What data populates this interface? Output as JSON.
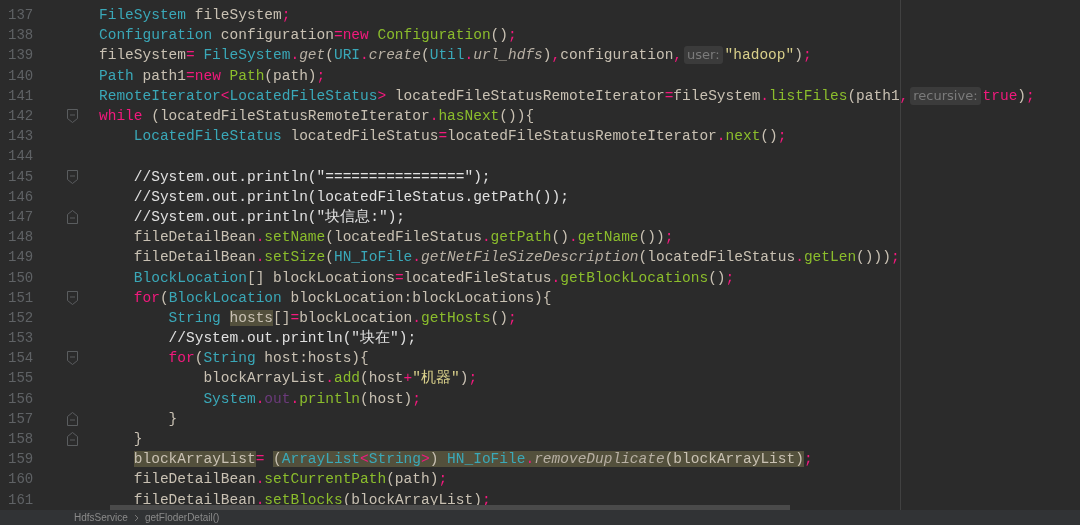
{
  "editor": {
    "lines": [
      {
        "number": "137",
        "fold_open": false,
        "fold_close": false,
        "tokens": [
          {
            "kind": "type",
            "t": "FileSystem",
            "highlighted": false
          },
          {
            "kind": "plain",
            "t": " fileSystem",
            "highlighted": false
          },
          {
            "kind": "punct",
            "t": ";",
            "highlighted": false
          }
        ]
      },
      {
        "number": "138",
        "fold_open": false,
        "fold_close": false,
        "tokens": [
          {
            "kind": "type",
            "t": "Configuration",
            "highlighted": false
          },
          {
            "kind": "plain",
            "t": " configuration",
            "highlighted": false
          },
          {
            "kind": "punct",
            "t": "=",
            "highlighted": false
          },
          {
            "kind": "kw",
            "t": "new",
            "highlighted": false
          },
          {
            "kind": "call",
            "t": " Configuration",
            "highlighted": false
          },
          {
            "kind": "plain",
            "t": "()",
            "highlighted": false
          },
          {
            "kind": "punct",
            "t": ";",
            "highlighted": false
          }
        ]
      },
      {
        "number": "139",
        "fold_open": false,
        "fold_close": false,
        "tokens": [
          {
            "kind": "plain",
            "t": "fileSystem",
            "highlighted": false
          },
          {
            "kind": "punct",
            "t": "=",
            "highlighted": false
          },
          {
            "kind": "type",
            "t": " FileSystem",
            "highlighted": false
          },
          {
            "kind": "punct",
            "t": ".",
            "highlighted": false
          },
          {
            "kind": "static",
            "t": "get",
            "highlighted": false
          },
          {
            "kind": "plain",
            "t": "(",
            "highlighted": false
          },
          {
            "kind": "type",
            "t": "URI",
            "highlighted": false
          },
          {
            "kind": "punct",
            "t": ".",
            "highlighted": false
          },
          {
            "kind": "static",
            "t": "create",
            "highlighted": false
          },
          {
            "kind": "plain",
            "t": "(",
            "highlighted": false
          },
          {
            "kind": "type",
            "t": "Util",
            "highlighted": false
          },
          {
            "kind": "punct",
            "t": ".",
            "highlighted": false
          },
          {
            "kind": "static",
            "t": "url_hdfs",
            "highlighted": false
          },
          {
            "kind": "plain",
            "t": ")",
            "highlighted": false
          },
          {
            "kind": "punct",
            "t": ",",
            "highlighted": false
          },
          {
            "kind": "plain",
            "t": "configuration",
            "highlighted": false
          },
          {
            "kind": "punct",
            "t": ",",
            "highlighted": false
          },
          {
            "kind": "hint",
            "t": "user:",
            "highlighted": false
          },
          {
            "kind": "str",
            "t": "\"hadoop\"",
            "highlighted": false
          },
          {
            "kind": "plain",
            "t": ")",
            "highlighted": false
          },
          {
            "kind": "punct",
            "t": ";",
            "highlighted": false
          }
        ]
      },
      {
        "number": "140",
        "fold_open": false,
        "fold_close": false,
        "tokens": [
          {
            "kind": "type",
            "t": "Path",
            "highlighted": false
          },
          {
            "kind": "plain",
            "t": " path1",
            "highlighted": false
          },
          {
            "kind": "punct",
            "t": "=",
            "highlighted": false
          },
          {
            "kind": "kw",
            "t": "new",
            "highlighted": false
          },
          {
            "kind": "call",
            "t": " Path",
            "highlighted": false
          },
          {
            "kind": "plain",
            "t": "(path)",
            "highlighted": false
          },
          {
            "kind": "punct",
            "t": ";",
            "highlighted": false
          }
        ]
      },
      {
        "number": "141",
        "fold_open": false,
        "fold_close": false,
        "tokens": [
          {
            "kind": "type",
            "t": "RemoteIterator",
            "highlighted": false
          },
          {
            "kind": "punct",
            "t": "<",
            "highlighted": false
          },
          {
            "kind": "type",
            "t": "LocatedFileStatus",
            "highlighted": false
          },
          {
            "kind": "punct",
            "t": ">",
            "highlighted": false
          },
          {
            "kind": "plain",
            "t": " locatedFileStatusRemoteIterator",
            "highlighted": false
          },
          {
            "kind": "punct",
            "t": "=",
            "highlighted": false
          },
          {
            "kind": "plain",
            "t": "fileSystem",
            "highlighted": false
          },
          {
            "kind": "punct",
            "t": ".",
            "highlighted": false
          },
          {
            "kind": "call",
            "t": "listFiles",
            "highlighted": false
          },
          {
            "kind": "plain",
            "t": "(path1",
            "highlighted": false
          },
          {
            "kind": "punct",
            "t": ",",
            "highlighted": false
          },
          {
            "kind": "hint",
            "t": "recursive:",
            "highlighted": false
          },
          {
            "kind": "kw",
            "t": "true",
            "highlighted": false
          },
          {
            "kind": "plain",
            "t": ")",
            "highlighted": false
          },
          {
            "kind": "punct",
            "t": ";",
            "highlighted": false
          }
        ]
      },
      {
        "number": "142",
        "fold_open": true,
        "fold_close": false,
        "tokens": [
          {
            "kind": "kw",
            "t": "while",
            "highlighted": false
          },
          {
            "kind": "plain",
            "t": " (locatedFileStatusRemoteIterator",
            "highlighted": false
          },
          {
            "kind": "punct",
            "t": ".",
            "highlighted": false
          },
          {
            "kind": "call",
            "t": "hasNext",
            "highlighted": false
          },
          {
            "kind": "plain",
            "t": "()){",
            "highlighted": false
          }
        ]
      },
      {
        "number": "143",
        "fold_open": false,
        "fold_close": false,
        "tokens": [
          {
            "kind": "type",
            "t": "    LocatedFileStatus",
            "highlighted": false
          },
          {
            "kind": "plain",
            "t": " locatedFileStatus",
            "highlighted": false
          },
          {
            "kind": "punct",
            "t": "=",
            "highlighted": false
          },
          {
            "kind": "plain",
            "t": "locatedFileStatusRemoteIterator",
            "highlighted": false
          },
          {
            "kind": "punct",
            "t": ".",
            "highlighted": false
          },
          {
            "kind": "call",
            "t": "next",
            "highlighted": false
          },
          {
            "kind": "plain",
            "t": "()",
            "highlighted": false
          },
          {
            "kind": "punct",
            "t": ";",
            "highlighted": false
          }
        ]
      },
      {
        "number": "144",
        "fold_open": false,
        "fold_close": false
      },
      {
        "number": "145",
        "fold_open": true,
        "fold_close": false,
        "tokens": [
          {
            "kind": "comment",
            "t": "    //System.out.println(\"================\");",
            "highlighted": false
          }
        ]
      },
      {
        "number": "146",
        "fold_open": false,
        "fold_close": false,
        "tokens": [
          {
            "kind": "comment",
            "t": "    //System.out.println(locatedFileStatus.getPath());",
            "highlighted": false
          }
        ]
      },
      {
        "number": "147",
        "fold_open": false,
        "fold_close": true,
        "tokens": [
          {
            "kind": "comment",
            "t": "    //System.out.println(\"块信息:\");",
            "highlighted": false
          }
        ]
      },
      {
        "number": "148",
        "fold_open": false,
        "fold_close": false,
        "tokens": [
          {
            "kind": "plain",
            "t": "    fileDetailBean",
            "highlighted": false
          },
          {
            "kind": "punct",
            "t": ".",
            "highlighted": false
          },
          {
            "kind": "call",
            "t": "setName",
            "highlighted": false
          },
          {
            "kind": "plain",
            "t": "(locatedFileStatus",
            "highlighted": false
          },
          {
            "kind": "punct",
            "t": ".",
            "highlighted": false
          },
          {
            "kind": "call",
            "t": "getPath",
            "highlighted": false
          },
          {
            "kind": "plain",
            "t": "()",
            "highlighted": false
          },
          {
            "kind": "punct",
            "t": ".",
            "highlighted": false
          },
          {
            "kind": "call",
            "t": "getName",
            "highlighted": false
          },
          {
            "kind": "plain",
            "t": "())",
            "highlighted": false
          },
          {
            "kind": "punct",
            "t": ";",
            "highlighted": false
          }
        ]
      },
      {
        "number": "149",
        "fold_open": false,
        "fold_close": false,
        "tokens": [
          {
            "kind": "plain",
            "t": "    fileDetailBean",
            "highlighted": false
          },
          {
            "kind": "punct",
            "t": ".",
            "highlighted": false
          },
          {
            "kind": "call",
            "t": "setSize",
            "highlighted": false
          },
          {
            "kind": "plain",
            "t": "(",
            "highlighted": false
          },
          {
            "kind": "type",
            "t": "HN_IoFile",
            "highlighted": false
          },
          {
            "kind": "punct",
            "t": ".",
            "highlighted": false
          },
          {
            "kind": "static",
            "t": "getNetFileSizeDescription",
            "highlighted": false
          },
          {
            "kind": "plain",
            "t": "(locatedFileStatus",
            "highlighted": false
          },
          {
            "kind": "punct",
            "t": ".",
            "highlighted": false
          },
          {
            "kind": "call",
            "t": "getLen",
            "highlighted": false
          },
          {
            "kind": "plain",
            "t": "()))",
            "highlighted": false
          },
          {
            "kind": "punct",
            "t": ";",
            "highlighted": false
          }
        ]
      },
      {
        "number": "150",
        "fold_open": false,
        "fold_close": false,
        "tokens": [
          {
            "kind": "type",
            "t": "    BlockLocation",
            "highlighted": false
          },
          {
            "kind": "plain",
            "t": "[] blockLocations",
            "highlighted": false
          },
          {
            "kind": "punct",
            "t": "=",
            "highlighted": false
          },
          {
            "kind": "plain",
            "t": "locatedFileStatus",
            "highlighted": false
          },
          {
            "kind": "punct",
            "t": ".",
            "highlighted": false
          },
          {
            "kind": "call",
            "t": "getBlockLocations",
            "highlighted": false
          },
          {
            "kind": "plain",
            "t": "()",
            "highlighted": false
          },
          {
            "kind": "punct",
            "t": ";",
            "highlighted": false
          }
        ]
      },
      {
        "number": "151",
        "fold_open": true,
        "fold_close": false,
        "tokens": [
          {
            "kind": "kw",
            "t": "    for",
            "highlighted": false
          },
          {
            "kind": "plain",
            "t": "(",
            "highlighted": false
          },
          {
            "kind": "type",
            "t": "BlockLocation",
            "highlighted": false
          },
          {
            "kind": "plain",
            "t": " blockLocation:blockLocations){",
            "highlighted": false
          }
        ]
      },
      {
        "number": "152",
        "fold_open": false,
        "fold_close": false,
        "tokens": [
          {
            "kind": "type",
            "t": "        String",
            "highlighted": false
          },
          {
            "kind": "plain",
            "t": " hosts",
            "highlighted": true
          },
          {
            "kind": "plain",
            "t": "[]",
            "highlighted": false
          },
          {
            "kind": "punct",
            "t": "=",
            "highlighted": false
          },
          {
            "kind": "plain",
            "t": "blockLocation",
            "highlighted": false
          },
          {
            "kind": "punct",
            "t": ".",
            "highlighted": false
          },
          {
            "kind": "call",
            "t": "getHosts",
            "highlighted": false
          },
          {
            "kind": "plain",
            "t": "()",
            "highlighted": false
          },
          {
            "kind": "punct",
            "t": ";",
            "highlighted": false
          }
        ]
      },
      {
        "number": "153",
        "fold_open": false,
        "fold_close": false,
        "tokens": [
          {
            "kind": "comment",
            "t": "        //System.out.println(\"块在\");",
            "highlighted": false
          }
        ]
      },
      {
        "number": "154",
        "fold_open": true,
        "fold_close": false,
        "tokens": [
          {
            "kind": "kw",
            "t": "        for",
            "highlighted": false
          },
          {
            "kind": "plain",
            "t": "(",
            "highlighted": false
          },
          {
            "kind": "type",
            "t": "String",
            "highlighted": false
          },
          {
            "kind": "plain",
            "t": " host:hosts){",
            "highlighted": false
          }
        ]
      },
      {
        "number": "155",
        "fold_open": false,
        "fold_close": false,
        "tokens": [
          {
            "kind": "plain",
            "t": "            blockArrayList",
            "highlighted": false
          },
          {
            "kind": "punct",
            "t": ".",
            "highlighted": false
          },
          {
            "kind": "call",
            "t": "add",
            "highlighted": false
          },
          {
            "kind": "plain",
            "t": "(host",
            "highlighted": false
          },
          {
            "kind": "punct",
            "t": "+",
            "highlighted": false
          },
          {
            "kind": "str",
            "t": "\"机器\"",
            "highlighted": false
          },
          {
            "kind": "plain",
            "t": ")",
            "highlighted": false
          },
          {
            "kind": "punct",
            "t": ";",
            "highlighted": false
          }
        ]
      },
      {
        "number": "156",
        "fold_open": false,
        "fold_close": false,
        "tokens": [
          {
            "kind": "type",
            "t": "            System",
            "highlighted": false
          },
          {
            "kind": "punct",
            "t": ".",
            "highlighted": false
          },
          {
            "kind": "field",
            "t": "out",
            "highlighted": false
          },
          {
            "kind": "punct",
            "t": ".",
            "highlighted": false
          },
          {
            "kind": "call",
            "t": "println",
            "highlighted": false
          },
          {
            "kind": "plain",
            "t": "(host)",
            "highlighted": false
          },
          {
            "kind": "punct",
            "t": ";",
            "highlighted": false
          }
        ]
      },
      {
        "number": "157",
        "fold_open": false,
        "fold_close": true,
        "tokens": [
          {
            "kind": "plain",
            "t": "        }",
            "highlighted": false
          }
        ]
      },
      {
        "number": "158",
        "fold_open": false,
        "fold_close": true,
        "tokens": [
          {
            "kind": "plain",
            "t": "    }",
            "highlighted": false
          }
        ]
      },
      {
        "number": "159",
        "fold_open": false,
        "fold_close": false,
        "tokens": [
          {
            "kind": "plain",
            "t": "    blockArrayList",
            "highlighted": true
          },
          {
            "kind": "punct",
            "t": "=",
            "highlighted": false
          },
          {
            "kind": "plain",
            "t": " (",
            "highlighted": true
          },
          {
            "kind": "type",
            "t": "ArrayList",
            "highlighted": true
          },
          {
            "kind": "punct",
            "t": "<",
            "highlighted": true
          },
          {
            "kind": "type",
            "t": "String",
            "highlighted": true
          },
          {
            "kind": "punct",
            "t": ">",
            "highlighted": true
          },
          {
            "kind": "plain",
            "t": ") ",
            "highlighted": true
          },
          {
            "kind": "type",
            "t": "HN_IoFile",
            "highlighted": true
          },
          {
            "kind": "punct",
            "t": ".",
            "highlighted": true
          },
          {
            "kind": "static",
            "t": "removeDuplicate",
            "highlighted": true
          },
          {
            "kind": "plain",
            "t": "(blockArrayList)",
            "highlighted": true
          },
          {
            "kind": "punct",
            "t": ";",
            "highlighted": false
          }
        ]
      },
      {
        "number": "160",
        "fold_open": false,
        "fold_close": false,
        "tokens": [
          {
            "kind": "plain",
            "t": "    fileDetailBean",
            "highlighted": false
          },
          {
            "kind": "punct",
            "t": ".",
            "highlighted": false
          },
          {
            "kind": "call",
            "t": "setCurrentPath",
            "highlighted": false
          },
          {
            "kind": "plain",
            "t": "(path)",
            "highlighted": false
          },
          {
            "kind": "punct",
            "t": ";",
            "highlighted": false
          }
        ]
      },
      {
        "number": "161",
        "fold_open": false,
        "fold_close": false,
        "tokens": [
          {
            "kind": "plain",
            "t": "    fileDetailBean",
            "highlighted": false
          },
          {
            "kind": "punct",
            "t": ".",
            "highlighted": false
          },
          {
            "kind": "call",
            "t": "setBlocks",
            "highlighted": false
          },
          {
            "kind": "plain",
            "t": "(blockArrayList)",
            "highlighted": false
          },
          {
            "kind": "punct",
            "t": ";",
            "highlighted": false
          }
        ]
      }
    ]
  },
  "breadcrumbs": [
    "HdfsService",
    "getFloderDetail()"
  ]
}
